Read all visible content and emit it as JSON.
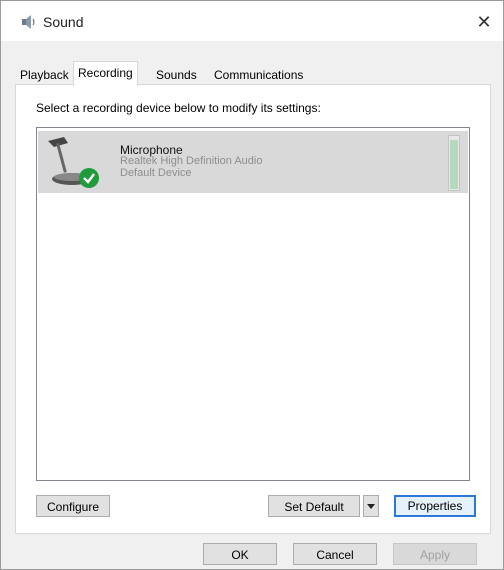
{
  "window": {
    "title": "Sound",
    "close_glyph": "✕"
  },
  "tabs": [
    {
      "label": "Playback",
      "active": false
    },
    {
      "label": "Recording",
      "active": true
    },
    {
      "label": "Sounds",
      "active": false
    },
    {
      "label": "Communications",
      "active": false
    }
  ],
  "panel": {
    "instruction": "Select a recording device below to modify its settings:",
    "devices": [
      {
        "name": "Microphone",
        "driver": "Realtek High Definition Audio",
        "status": "Default Device",
        "icon": "microphone-icon",
        "badge_icon": "default-check-icon",
        "level": 0.9,
        "selected": true
      }
    ],
    "configure_label": "Configure",
    "set_default_label": "Set Default",
    "properties_label": "Properties"
  },
  "footer": {
    "ok_label": "OK",
    "cancel_label": "Cancel",
    "apply_label": "Apply"
  },
  "colors": {
    "accent": "#2b78d8",
    "selection": "#d9d9d9",
    "check_green": "#1e9b3b"
  }
}
